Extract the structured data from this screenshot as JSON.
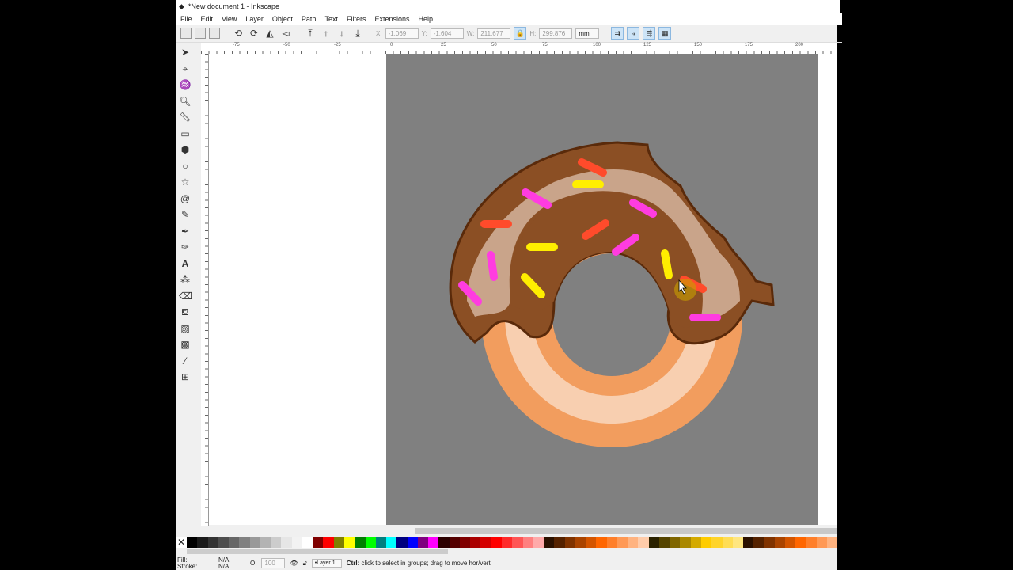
{
  "title": "*New document 1 - Inkscape",
  "menu": [
    "File",
    "Edit",
    "View",
    "Layer",
    "Object",
    "Path",
    "Text",
    "Filters",
    "Extensions",
    "Help"
  ],
  "toolbar": {
    "x_label": "X:",
    "x": "-1.069",
    "y_label": "Y:",
    "y": "-1.604",
    "w_label": "W:",
    "w": "211.677",
    "h_label": "H:",
    "h": "299.876",
    "unit": "mm"
  },
  "ruler_labels": [
    "-75",
    "-50",
    "-25",
    "0",
    "25",
    "50",
    "75",
    "100",
    "125",
    "150",
    "175",
    "200"
  ],
  "palette": [
    "#000000",
    "#1a1a1a",
    "#333333",
    "#4d4d4d",
    "#666666",
    "#808080",
    "#999999",
    "#b3b3b3",
    "#cccccc",
    "#e6e6e6",
    "#f2f2f2",
    "#ffffff",
    "#800000",
    "#ff0000",
    "#808000",
    "#ffff00",
    "#008000",
    "#00ff00",
    "#008080",
    "#00ffff",
    "#000080",
    "#0000ff",
    "#800080",
    "#ff00ff",
    "#2b0000",
    "#550000",
    "#800000",
    "#aa0000",
    "#d40000",
    "#ff0000",
    "#ff2a2a",
    "#ff5555",
    "#ff8080",
    "#ffaaaa",
    "#2b1100",
    "#552200",
    "#803300",
    "#aa4400",
    "#d45500",
    "#ff6600",
    "#ff7f2a",
    "#ff9955",
    "#ffb380",
    "#ffccaa",
    "#2b2200",
    "#554400",
    "#806600",
    "#aa8800",
    "#d4aa00",
    "#ffcc00",
    "#ffd42a",
    "#ffdd55",
    "#ffe680",
    "#2b1100",
    "#552200",
    "#803300",
    "#aa4400",
    "#d45500",
    "#ff6600",
    "#ff7f2a",
    "#ff9955",
    "#ffb380"
  ],
  "status": {
    "fill_label": "Fill:",
    "fill": "N/A",
    "stroke_label": "Stroke:",
    "stroke": "N/A",
    "opacity_label": "O:",
    "opacity": "100",
    "layer": "•Layer 1",
    "message_bold": "Ctrl:",
    "message": "click to select in groups; drag to move hor/vert"
  },
  "colors": {
    "page": "#808080",
    "icing": "#8b4f24",
    "icing_light": "#c9a48a",
    "dough": "#f29d5e",
    "dough_light": "#f8cfb0",
    "sprinkle_red": "#ff4b2b",
    "sprinkle_yellow": "#ffee00",
    "sprinkle_pink": "#ff3ce0"
  }
}
